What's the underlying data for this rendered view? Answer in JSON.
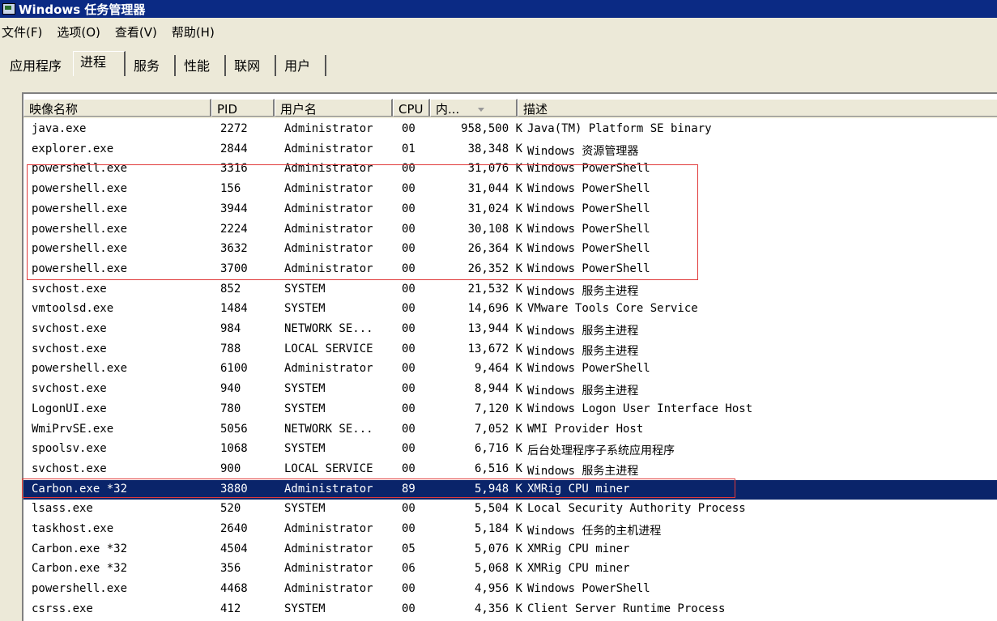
{
  "window": {
    "title": "Windows 任务管理器"
  },
  "menu": {
    "items": [
      "文件(F)",
      "选项(O)",
      "查看(V)",
      "帮助(H)"
    ]
  },
  "tabs": {
    "items": [
      "应用程序",
      "进程",
      "服务",
      "性能",
      "联网",
      "用户"
    ],
    "active": "进程"
  },
  "columns": {
    "name": "映像名称",
    "pid": "PID",
    "user": "用户名",
    "cpu": "CPU",
    "mem": "内...",
    "desc": "描述"
  },
  "processes": [
    {
      "name": "java.exe",
      "pid": "2272",
      "user": "Administrator",
      "cpu": "00",
      "mem": "958,500 K",
      "desc": "Java(TM) Platform SE binary"
    },
    {
      "name": "explorer.exe",
      "pid": "2844",
      "user": "Administrator",
      "cpu": "01",
      "mem": "38,348 K",
      "desc": "Windows 资源管理器"
    },
    {
      "name": "powershell.exe",
      "pid": "3316",
      "user": "Administrator",
      "cpu": "00",
      "mem": "31,076 K",
      "desc": "Windows PowerShell"
    },
    {
      "name": "powershell.exe",
      "pid": "156",
      "user": "Administrator",
      "cpu": "00",
      "mem": "31,044 K",
      "desc": "Windows PowerShell"
    },
    {
      "name": "powershell.exe",
      "pid": "3944",
      "user": "Administrator",
      "cpu": "00",
      "mem": "31,024 K",
      "desc": "Windows PowerShell"
    },
    {
      "name": "powershell.exe",
      "pid": "2224",
      "user": "Administrator",
      "cpu": "00",
      "mem": "30,108 K",
      "desc": "Windows PowerShell"
    },
    {
      "name": "powershell.exe",
      "pid": "3632",
      "user": "Administrator",
      "cpu": "00",
      "mem": "26,364 K",
      "desc": "Windows PowerShell"
    },
    {
      "name": "powershell.exe",
      "pid": "3700",
      "user": "Administrator",
      "cpu": "00",
      "mem": "26,352 K",
      "desc": "Windows PowerShell"
    },
    {
      "name": "svchost.exe",
      "pid": "852",
      "user": "SYSTEM",
      "cpu": "00",
      "mem": "21,532 K",
      "desc": "Windows 服务主进程"
    },
    {
      "name": "vmtoolsd.exe",
      "pid": "1484",
      "user": "SYSTEM",
      "cpu": "00",
      "mem": "14,696 K",
      "desc": "VMware Tools Core Service"
    },
    {
      "name": "svchost.exe",
      "pid": "984",
      "user": "NETWORK SE...",
      "cpu": "00",
      "mem": "13,944 K",
      "desc": "Windows 服务主进程"
    },
    {
      "name": "svchost.exe",
      "pid": "788",
      "user": "LOCAL SERVICE",
      "cpu": "00",
      "mem": "13,672 K",
      "desc": "Windows 服务主进程"
    },
    {
      "name": "powershell.exe",
      "pid": "6100",
      "user": "Administrator",
      "cpu": "00",
      "mem": "9,464 K",
      "desc": "Windows PowerShell"
    },
    {
      "name": "svchost.exe",
      "pid": "940",
      "user": "SYSTEM",
      "cpu": "00",
      "mem": "8,944 K",
      "desc": "Windows 服务主进程"
    },
    {
      "name": "LogonUI.exe",
      "pid": "780",
      "user": "SYSTEM",
      "cpu": "00",
      "mem": "7,120 K",
      "desc": "Windows Logon User Interface Host"
    },
    {
      "name": "WmiPrvSE.exe",
      "pid": "5056",
      "user": "NETWORK SE...",
      "cpu": "00",
      "mem": "7,052 K",
      "desc": "WMI Provider Host"
    },
    {
      "name": "spoolsv.exe",
      "pid": "1068",
      "user": "SYSTEM",
      "cpu": "00",
      "mem": "6,716 K",
      "desc": "后台处理程序子系统应用程序"
    },
    {
      "name": "svchost.exe",
      "pid": "900",
      "user": "LOCAL SERVICE",
      "cpu": "00",
      "mem": "6,516 K",
      "desc": "Windows 服务主进程"
    },
    {
      "name": "Carbon.exe *32",
      "pid": "3880",
      "user": "Administrator",
      "cpu": "89",
      "mem": "5,948 K",
      "desc": "XMRig CPU miner",
      "selected": true
    },
    {
      "name": "lsass.exe",
      "pid": "520",
      "user": "SYSTEM",
      "cpu": "00",
      "mem": "5,504 K",
      "desc": "Local Security Authority Process"
    },
    {
      "name": "taskhost.exe",
      "pid": "2640",
      "user": "Administrator",
      "cpu": "00",
      "mem": "5,184 K",
      "desc": "Windows 任务的主机进程"
    },
    {
      "name": "Carbon.exe *32",
      "pid": "4504",
      "user": "Administrator",
      "cpu": "05",
      "mem": "5,076 K",
      "desc": "XMRig CPU miner"
    },
    {
      "name": "Carbon.exe *32",
      "pid": "356",
      "user": "Administrator",
      "cpu": "06",
      "mem": "5,068 K",
      "desc": "XMRig CPU miner"
    },
    {
      "name": "powershell.exe",
      "pid": "4468",
      "user": "Administrator",
      "cpu": "00",
      "mem": "4,956 K",
      "desc": "Windows PowerShell"
    },
    {
      "name": "csrss.exe",
      "pid": "412",
      "user": "SYSTEM",
      "cpu": "00",
      "mem": "4,356 K",
      "desc": "Client Server Runtime Process"
    }
  ],
  "colors": {
    "titlebar": "#0b2a84",
    "selection": "#0a246a",
    "annotation": "#e03a3a"
  }
}
